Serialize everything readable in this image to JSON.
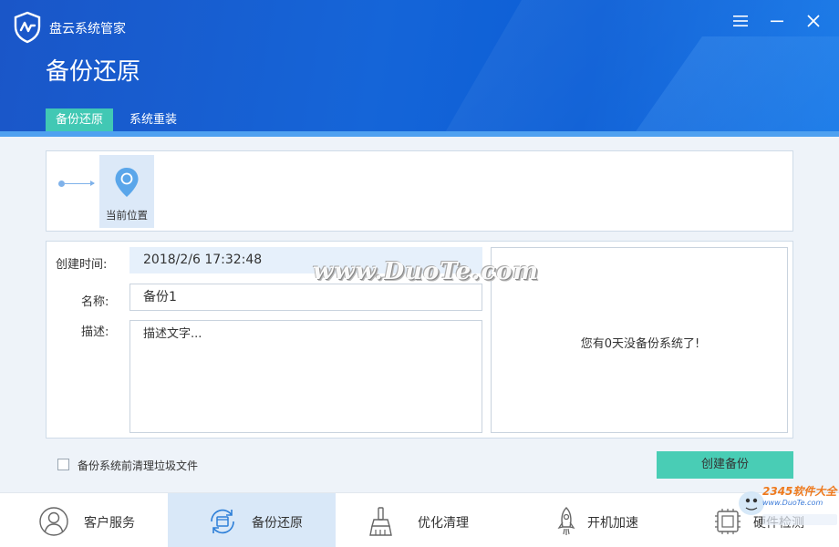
{
  "app": {
    "name": "盘云系统管家"
  },
  "header": {
    "title": "备份还原"
  },
  "tabs": [
    {
      "label": "备份还原",
      "active": true
    },
    {
      "label": "系统重装",
      "active": false
    }
  ],
  "timeline": {
    "current_label": "当前位置"
  },
  "form": {
    "time_label": "创建时间:",
    "time_value": "2018/2/6  17:32:48",
    "name_label": "名称:",
    "name_value": "备份1",
    "desc_label": "描述:",
    "desc_placeholder": "描述文字..."
  },
  "side_panel": {
    "message": "您有0天没备份系统了!"
  },
  "watermark": "www.DuoTe.com",
  "options": {
    "clean_checkbox_label": "备份系统前清理垃圾文件",
    "clean_checked": false
  },
  "actions": {
    "create_label": "创建备份"
  },
  "bottom_nav": [
    {
      "label": "客户服务",
      "icon": "user-icon",
      "active": false
    },
    {
      "label": "备份还原",
      "icon": "backup-restore-icon",
      "active": true
    },
    {
      "label": "优化清理",
      "icon": "broom-icon",
      "active": false
    },
    {
      "label": "开机加速",
      "icon": "rocket-icon",
      "active": false
    },
    {
      "label": "硬件检测",
      "icon": "chip-icon",
      "active": false
    }
  ],
  "corner_badge": {
    "brand": "2345软件大全",
    "url": "www.DuoTe.com"
  },
  "colors": {
    "header_blue": "#1565d8",
    "accent_teal": "#41c8b4",
    "button_teal": "#49cdb5",
    "active_nav_bg": "#d9e8f8"
  }
}
